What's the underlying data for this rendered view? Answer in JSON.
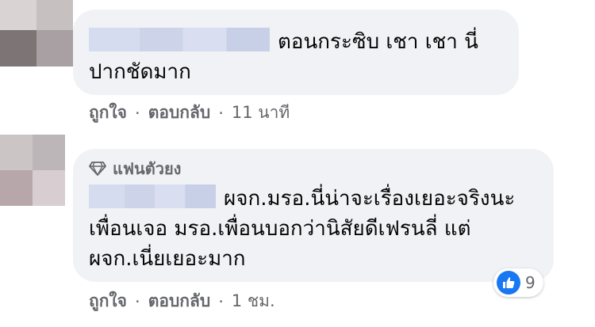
{
  "comments": [
    {
      "text": "ตอนกระซิบ เชา เชา นี่ ปากชัดมาก",
      "actions": {
        "like_label": "ถูกใจ",
        "reply_label": "ตอบกลับ",
        "separator": "·",
        "time": "11 นาที"
      }
    },
    {
      "badge_label": "แฟนตัวยง",
      "badge_icon": "diamond-icon",
      "text": "ผจก.มรอ.นี่น่าจะเรื่องเยอะจริงนะ เพื่อนเจอ มรอ.เพื่อนบอกว่านิสัยดีเฟรนลี่ แต่ ผจก.เนี่ยเยอะมาก",
      "actions": {
        "like_label": "ถูกใจ",
        "reply_label": "ตอบกลับ",
        "separator": "·",
        "time": "1 ชม."
      },
      "reaction": {
        "icon": "like-icon",
        "count": "9",
        "color": "#1877f2"
      }
    }
  ],
  "colors": {
    "bubble": "#f0f2f5",
    "muted_text": "#65676b",
    "like_blue": "#1877f2"
  }
}
